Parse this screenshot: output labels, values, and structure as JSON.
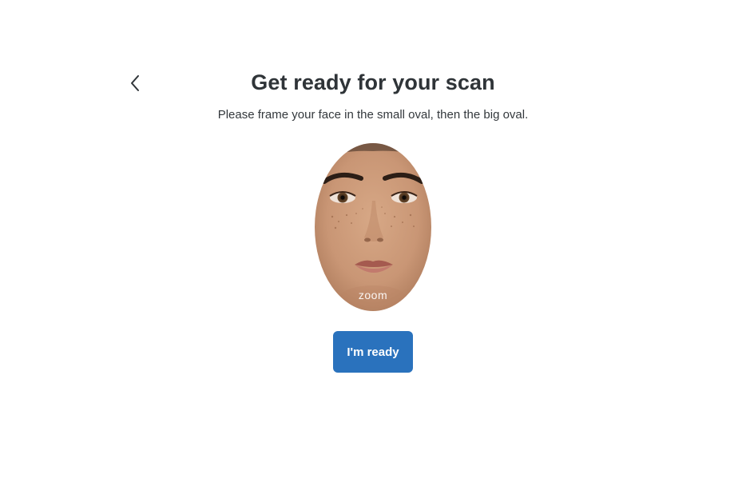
{
  "header": {
    "back_icon": "chevron-left-icon",
    "title": "Get ready for your scan",
    "subtitle": "Please frame your face in the small oval, then the big oval."
  },
  "preview": {
    "brand_mark": "zoom"
  },
  "actions": {
    "ready_label": "I'm ready",
    "accent_color": "#2a72bd"
  }
}
